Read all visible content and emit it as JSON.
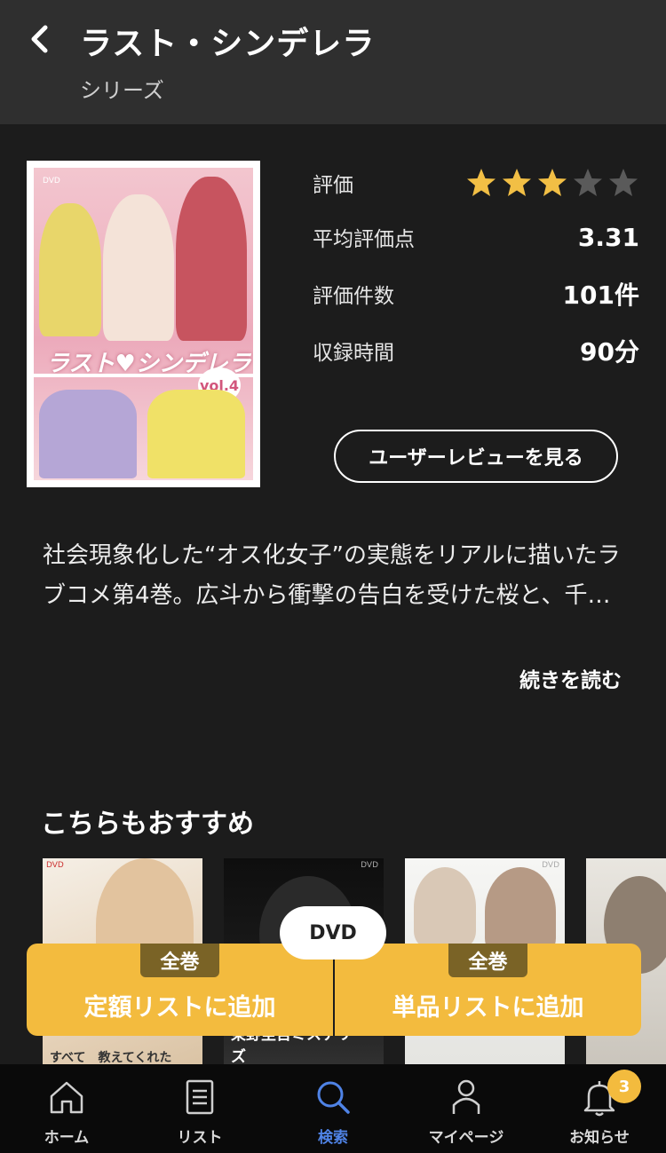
{
  "header": {
    "title": "ラスト・シンデレラ",
    "subtitle": "シリーズ"
  },
  "poster": {
    "logo_text": "ラスト♥シンデレラ",
    "vol_text": "vol.4"
  },
  "info": {
    "rating_label": "評価",
    "rating_stars": 3,
    "rating_max": 5,
    "avg_label": "平均評価点",
    "avg_value": "3.31",
    "count_label": "評価件数",
    "count_value": "101件",
    "duration_label": "収録時間",
    "duration_value": "90分"
  },
  "review_button": "ユーザーレビューを見る",
  "description": "社会現象化した“オス化女子”の実態をリアルに描いたラブコメ第4巻。広斗から衝撃の告白を受けた桜と、千…",
  "read_more": "続きを読む",
  "recommend": {
    "title": "こちらもおすすめ",
    "items": [
      {
        "caption": "すべて　教えてくれた"
      },
      {
        "caption": "東野圭吾ミステリーズ"
      },
      {
        "caption": ""
      },
      {
        "caption": ""
      }
    ]
  },
  "add_bar": {
    "format_pill": "DVD",
    "left_badge": "全巻",
    "left_label": "定額リストに追加",
    "right_badge": "全巻",
    "right_label": "単品リストに追加"
  },
  "nav": {
    "items": [
      {
        "label": "ホーム",
        "icon": "home-icon"
      },
      {
        "label": "リスト",
        "icon": "list-icon"
      },
      {
        "label": "検索",
        "icon": "search-icon",
        "active": true
      },
      {
        "label": "マイページ",
        "icon": "person-icon"
      },
      {
        "label": "お知らせ",
        "icon": "bell-icon"
      }
    ],
    "notification_count": "3"
  },
  "colors": {
    "background": "#1c1c1c",
    "header": "#2f2f2f",
    "accent_yellow": "#f3bb3e",
    "star_on": "#f2bf45",
    "star_off": "#5a5a5a",
    "active_nav": "#4f83e6"
  }
}
